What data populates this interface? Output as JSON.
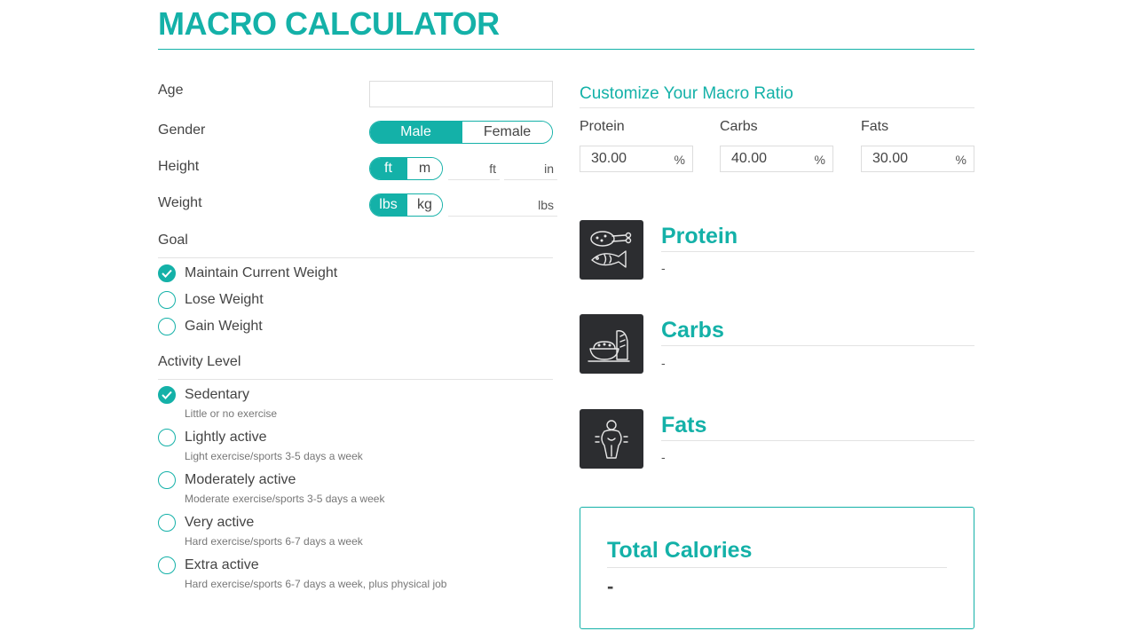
{
  "page": {
    "title": "MACRO CALCULATOR"
  },
  "colors": {
    "accent": "#14b1a8",
    "icon_bg": "#2c2d30"
  },
  "form": {
    "age": {
      "label": "Age",
      "value": ""
    },
    "gender": {
      "label": "Gender",
      "options": [
        "Male",
        "Female"
      ],
      "selected": "Male"
    },
    "height": {
      "label": "Height",
      "units": [
        "ft",
        "m"
      ],
      "selected_unit": "ft",
      "feet_unit": "ft",
      "inches_unit": "in"
    },
    "weight": {
      "label": "Weight",
      "units": [
        "lbs",
        "kg"
      ],
      "selected_unit": "lbs",
      "field_unit": "lbs"
    },
    "goal": {
      "label": "Goal",
      "selected": "Maintain Current Weight",
      "options": [
        {
          "label": "Maintain Current Weight"
        },
        {
          "label": "Lose Weight"
        },
        {
          "label": "Gain Weight"
        }
      ]
    },
    "activity": {
      "label": "Activity Level",
      "selected": "Sedentary",
      "options": [
        {
          "label": "Sedentary",
          "desc": "Little or no exercise"
        },
        {
          "label": "Lightly active",
          "desc": "Light exercise/sports 3-5 days a week"
        },
        {
          "label": "Moderately active",
          "desc": "Moderate exercise/sports 3-5 days a week"
        },
        {
          "label": "Very active",
          "desc": "Hard exercise/sports 6-7 days a week"
        },
        {
          "label": "Extra active",
          "desc": "Hard exercise/sports 6-7 days a week, plus physical job"
        }
      ]
    }
  },
  "ratio": {
    "title": "Customize Your Macro Ratio",
    "unit": "%",
    "protein": {
      "label": "Protein",
      "value": "30.00"
    },
    "carbs": {
      "label": "Carbs",
      "value": "40.00"
    },
    "fats": {
      "label": "Fats",
      "value": "30.00"
    }
  },
  "results": {
    "protein": {
      "name": "Protein",
      "value": "-",
      "icon": "food-icon"
    },
    "carbs": {
      "name": "Carbs",
      "value": "-",
      "icon": "bread-bowl-icon"
    },
    "fats": {
      "name": "Fats",
      "value": "-",
      "icon": "body-fat-icon"
    },
    "calories": {
      "title": "Total Calories",
      "value": "-"
    }
  }
}
